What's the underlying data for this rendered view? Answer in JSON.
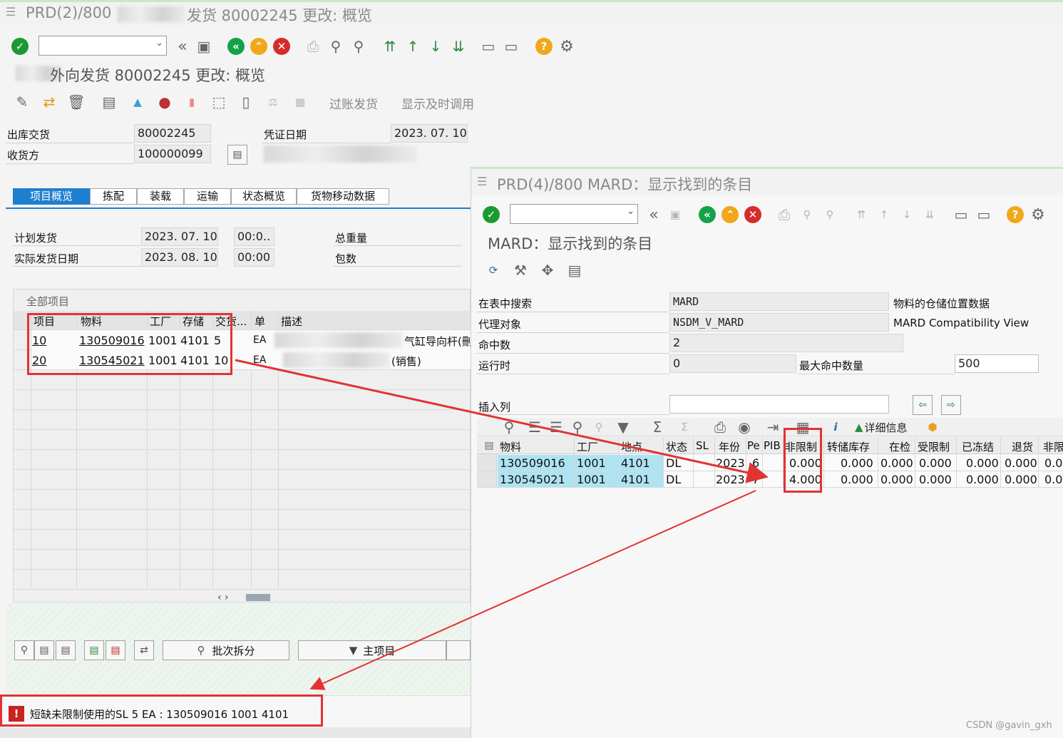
{
  "main": {
    "window_title": "PRD(2)/800",
    "window_title_tail": "发货 80002245 更改: 概览",
    "app_title": "外向发货 80002245 更改: 概览",
    "toolbar_labels": {
      "post": "过账发货",
      "display_call": "显示及时调用"
    },
    "header": {
      "delivery_label": "出库交货",
      "delivery_value": "80002245",
      "doc_date_label": "凭证日期",
      "doc_date_value": "2023. 07. 10",
      "shipto_label": "收货方",
      "shipto_value": "100000099"
    },
    "tabs": [
      "项目概览",
      "拣配",
      "装载",
      "运输",
      "状态概览",
      "货物移动数据"
    ],
    "dates": {
      "planned_label": "计划发货",
      "planned_date": "2023. 07. 10",
      "planned_time": "00:0..",
      "actual_label": "实际发货日期",
      "actual_date": "2023. 08. 10",
      "actual_time": "00:00",
      "total_weight_label": "总重量",
      "packages_label": "包数"
    },
    "items": {
      "section_title": "全部项目",
      "columns": [
        "项目",
        "物料",
        "工厂",
        "存储",
        "交货...",
        "单",
        "描述"
      ],
      "rows": [
        {
          "item": "10",
          "material": "130509016",
          "plant": "1001",
          "sloc": "4101",
          "qty": "5",
          "unit": "EA",
          "desc": "气缸导向杆(刪"
        },
        {
          "item": "20",
          "material": "130545021",
          "plant": "1001",
          "sloc": "4101",
          "qty": "10",
          "unit": "EA",
          "desc": "(销售)"
        }
      ],
      "scroll": "‹ ›"
    },
    "buttons": {
      "batch_split": "批次拆分",
      "main_item": "主项目"
    },
    "status_message": "短缺未限制使用的SL 5 EA : 130509016 1001 4101"
  },
  "popup": {
    "window_title": "PRD(4)/800 MARD：显示找到的条目",
    "app_title": "MARD：显示找到的条目",
    "fields": {
      "search_table_label": "在表中搜索",
      "search_table_value": "MARD",
      "search_table_desc": "物料的仓储位置数据",
      "proxy_label": "代理对象",
      "proxy_value": "NSDM_V_MARD",
      "proxy_desc": "MARD Compatibility View",
      "hits_label": "命中数",
      "hits_value": "2",
      "runtime_label": "运行时",
      "runtime_value": "0",
      "max_hits_label": "最大命中数量",
      "max_hits_value": "500",
      "insert_col_label": "插入列"
    },
    "alv_toolbar": {
      "details": "详细信息"
    },
    "columns": [
      "物料",
      "工厂",
      "地点",
      "状态",
      "SL",
      "年份",
      "Pe",
      "PIB",
      "非限制",
      "转储库存",
      "在检",
      "受限制",
      "已冻结",
      "退货",
      "非限"
    ],
    "rows": [
      {
        "material": "130509016",
        "plant": "1001",
        "loc": "4101",
        "status": "DL",
        "year": "2023",
        "pe": "6",
        "unrestricted": "0.000",
        "transfer": "0.000",
        "qi": "0.000",
        "restricted": "0.000",
        "blocked": "0.000",
        "returns": "0.000",
        "more": "0.0"
      },
      {
        "material": "130545021",
        "plant": "1001",
        "loc": "4101",
        "status": "DL",
        "year": "2023",
        "pe": "7",
        "unrestricted": "4.000",
        "transfer": "0.000",
        "qi": "0.000",
        "restricted": "0.000",
        "blocked": "0.000",
        "returns": "0.000",
        "more": "0.0"
      }
    ]
  },
  "watermark": "CSDN @gavin_gxh",
  "colors": {
    "annotation_red": "#e23333",
    "key_cell": "#aee3f2",
    "active_tab": "#1d7fcf"
  }
}
